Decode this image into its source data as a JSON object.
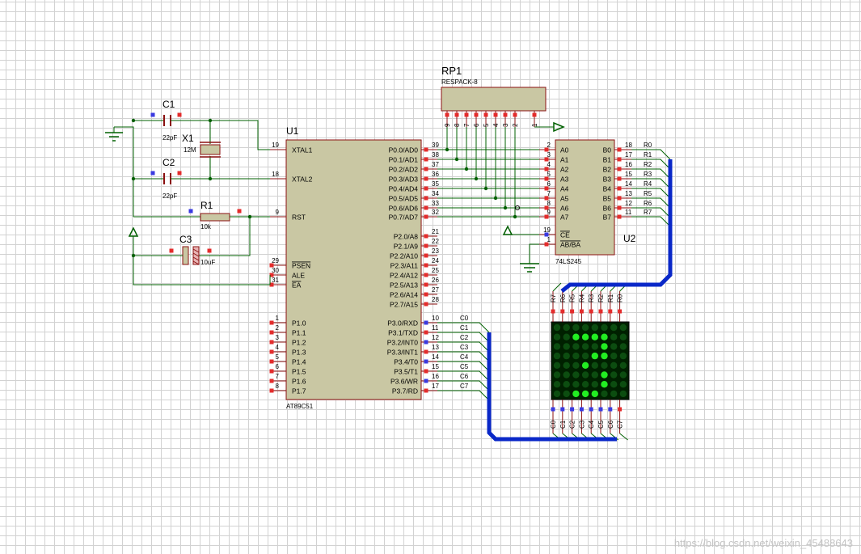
{
  "schematic": {
    "u1": {
      "ref": "U1",
      "part": "AT89C51",
      "left_pins": [
        {
          "num": "19",
          "name": "XTAL1"
        },
        {
          "num": "18",
          "name": "XTAL2"
        },
        {
          "num": "9",
          "name": "RST"
        },
        {
          "num": "29",
          "name": "PSEN"
        },
        {
          "num": "30",
          "name": "ALE"
        },
        {
          "num": "31",
          "name": "EA"
        },
        {
          "num": "1",
          "name": "P1.0"
        },
        {
          "num": "2",
          "name": "P1.1"
        },
        {
          "num": "3",
          "name": "P1.2"
        },
        {
          "num": "4",
          "name": "P1.3"
        },
        {
          "num": "5",
          "name": "P1.4"
        },
        {
          "num": "6",
          "name": "P1.5"
        },
        {
          "num": "7",
          "name": "P1.6"
        },
        {
          "num": "8",
          "name": "P1.7"
        }
      ],
      "right_pins": [
        {
          "num": "39",
          "name": "P0.0/AD0"
        },
        {
          "num": "38",
          "name": "P0.1/AD1"
        },
        {
          "num": "37",
          "name": "P0.2/AD2"
        },
        {
          "num": "36",
          "name": "P0.3/AD3"
        },
        {
          "num": "35",
          "name": "P0.4/AD4"
        },
        {
          "num": "34",
          "name": "P0.5/AD5"
        },
        {
          "num": "33",
          "name": "P0.6/AD6"
        },
        {
          "num": "32",
          "name": "P0.7/AD7"
        },
        {
          "num": "21",
          "name": "P2.0/A8"
        },
        {
          "num": "22",
          "name": "P2.1/A9"
        },
        {
          "num": "23",
          "name": "P2.2/A10"
        },
        {
          "num": "24",
          "name": "P2.3/A11"
        },
        {
          "num": "25",
          "name": "P2.4/A12"
        },
        {
          "num": "26",
          "name": "P2.5/A13"
        },
        {
          "num": "27",
          "name": "P2.6/A14"
        },
        {
          "num": "28",
          "name": "P2.7/A15"
        },
        {
          "num": "10",
          "name": "P3.0/RXD",
          "net": "C0"
        },
        {
          "num": "11",
          "name": "P3.1/TXD",
          "net": "C1"
        },
        {
          "num": "12",
          "name": "P3.2/INT0",
          "net": "C2"
        },
        {
          "num": "13",
          "name": "P3.3/INT1",
          "net": "C3"
        },
        {
          "num": "14",
          "name": "P3.4/T0",
          "net": "C4"
        },
        {
          "num": "15",
          "name": "P3.5/T1",
          "net": "C5"
        },
        {
          "num": "16",
          "name": "P3.6/WR",
          "net": "C6"
        },
        {
          "num": "17",
          "name": "P3.7/RD",
          "net": "C7"
        }
      ]
    },
    "u2": {
      "ref": "U2",
      "part": "74LS245",
      "a_pins": [
        {
          "num": "2",
          "name": "A0"
        },
        {
          "num": "3",
          "name": "A1"
        },
        {
          "num": "4",
          "name": "A2"
        },
        {
          "num": "5",
          "name": "A3"
        },
        {
          "num": "6",
          "name": "A4"
        },
        {
          "num": "7",
          "name": "A5"
        },
        {
          "num": "8",
          "name": "A6"
        },
        {
          "num": "9",
          "name": "A7"
        }
      ],
      "ctrl_pins": [
        {
          "num": "19",
          "name": "CE"
        },
        {
          "num": "1",
          "name": "AB/BA"
        }
      ],
      "b_pins": [
        {
          "num": "18",
          "name": "B0",
          "net": "R0"
        },
        {
          "num": "17",
          "name": "B1",
          "net": "R1"
        },
        {
          "num": "16",
          "name": "B2",
          "net": "R2"
        },
        {
          "num": "15",
          "name": "B3",
          "net": "R3"
        },
        {
          "num": "14",
          "name": "B4",
          "net": "R4"
        },
        {
          "num": "13",
          "name": "B5",
          "net": "R5"
        },
        {
          "num": "12",
          "name": "B6",
          "net": "R6"
        },
        {
          "num": "11",
          "name": "B7",
          "net": "R7"
        }
      ]
    },
    "rp1": {
      "ref": "RP1",
      "part": "RESPACK-8",
      "pins": [
        "9",
        "8",
        "7",
        "6",
        "5",
        "4",
        "3",
        "2",
        "1"
      ]
    },
    "c1": {
      "ref": "C1",
      "value": "22pF"
    },
    "c2": {
      "ref": "C2",
      "value": "22pF"
    },
    "x1": {
      "ref": "X1",
      "value": "12M"
    },
    "r1": {
      "ref": "R1",
      "value": "10k"
    },
    "c3": {
      "ref": "C3",
      "value": "10uF"
    },
    "matrix": {
      "top_labels": [
        "R7",
        "R6",
        "R5",
        "R4",
        "R3",
        "R2",
        "R1",
        "R0"
      ],
      "bottom_labels": [
        "C0",
        "C1",
        "C2",
        "C3",
        "C4",
        "C5",
        "C6",
        "C7"
      ],
      "lit": [
        [
          0,
          0,
          0,
          0,
          0,
          0,
          0,
          0
        ],
        [
          0,
          0,
          1,
          1,
          1,
          1,
          0,
          0
        ],
        [
          0,
          0,
          0,
          0,
          0,
          1,
          0,
          0
        ],
        [
          0,
          0,
          0,
          0,
          1,
          1,
          0,
          0
        ],
        [
          0,
          0,
          0,
          1,
          0,
          0,
          0,
          0
        ],
        [
          0,
          0,
          0,
          0,
          0,
          1,
          0,
          0
        ],
        [
          0,
          0,
          0,
          0,
          0,
          1,
          0,
          0
        ],
        [
          0,
          0,
          1,
          1,
          1,
          0,
          0,
          0
        ]
      ],
      "colors": {
        "on": "#22ee22",
        "off": "#0c4d10",
        "frame": "#002000"
      }
    },
    "colors": {
      "wire": "#006000",
      "bus": "#0a28c8",
      "body": "#c9c7a3",
      "border": "#8b1010",
      "pin": "#8b1010",
      "red_port": "#e42c2c",
      "blue_port": "#3a3ae0"
    }
  },
  "watermark": "https://blog.csdn.net/weixin_45488643"
}
